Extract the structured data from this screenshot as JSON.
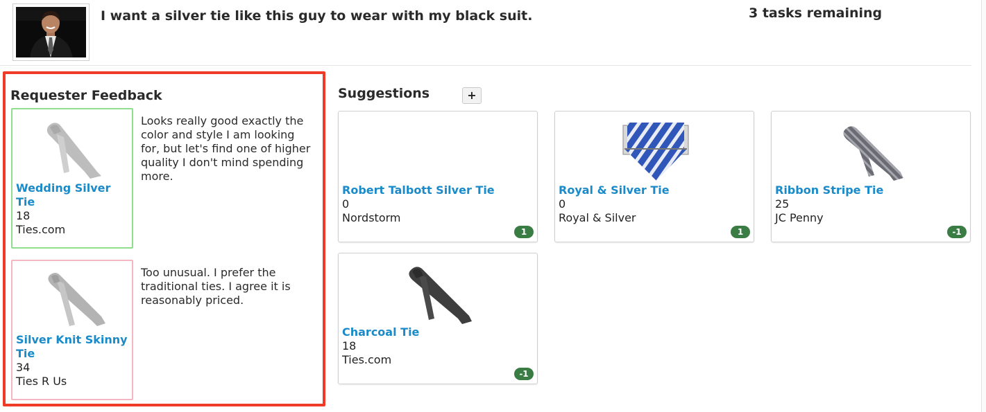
{
  "header": {
    "request": "I want a silver tie like this guy to wear with my black suit.",
    "tasks_remaining": "3 tasks remaining"
  },
  "feedback": {
    "title": "Requester Feedback",
    "items": [
      {
        "name": "Wedding Silver Tie",
        "price": "18",
        "store": "Ties.com",
        "comment": "Looks really good exactly the color and style I am looking for, but let's find one of higher quality I don't mind spending more.",
        "status_color": "#8fdf8f"
      },
      {
        "name": "Silver Knit Skinny Tie",
        "price": "34",
        "store": "Ties R Us",
        "comment": "Too unusual. I prefer the traditional ties. I agree it is reasonably priced.",
        "status_color": "#f4b6c2"
      }
    ]
  },
  "suggestions": {
    "title": "Suggestions",
    "add_label": "+",
    "items": [
      {
        "name": "Robert Talbott Silver Tie",
        "price": "0",
        "store": "Nordstorm",
        "votes": "1",
        "image": "none"
      },
      {
        "name": "Royal & Silver Tie",
        "price": "0",
        "store": "Royal & Silver",
        "votes": "1",
        "image": "blue-striped-tie-box-icon"
      },
      {
        "name": "Ribbon Stripe Tie",
        "price": "25",
        "store": "JC Penny",
        "votes": "-1",
        "image": "striped-tie-icon"
      },
      {
        "name": "Charcoal Tie",
        "price": "18",
        "store": "Ties.com",
        "votes": "-1",
        "image": "charcoal-tie-icon"
      }
    ]
  },
  "colors": {
    "highlight_border": "#f03a28",
    "link": "#1a8ac8",
    "badge": "#3a7d44"
  }
}
